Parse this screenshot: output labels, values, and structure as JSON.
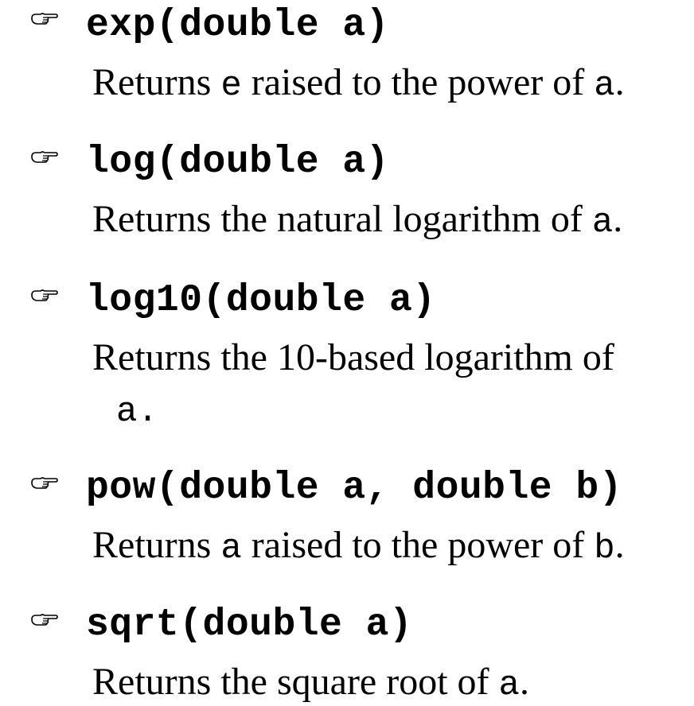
{
  "bullet_icon": "pointing-hand-icon",
  "methods": [
    {
      "signature": "exp(double a)",
      "desc_before": "Returns ",
      "desc_code1": "e",
      "desc_middle": " raised to the power of ",
      "desc_code2": "a",
      "desc_after": "."
    },
    {
      "signature": "log(double a)",
      "desc_before": "Returns the natural logarithm of ",
      "desc_code": "a",
      "desc_after": "."
    },
    {
      "signature": "log10(double a)",
      "desc_line1": "Returns the 10-based logarithm of",
      "desc_line2_code": "a",
      "desc_line2_after": "."
    },
    {
      "signature": "pow(double a, double b)",
      "desc_before": "Returns ",
      "desc_code1": "a",
      "desc_middle": " raised to the power of ",
      "desc_code2": "b",
      "desc_after": "."
    },
    {
      "signature": "sqrt(double a)",
      "desc_before": "Returns the square root of ",
      "desc_code": "a",
      "desc_after": "."
    }
  ]
}
